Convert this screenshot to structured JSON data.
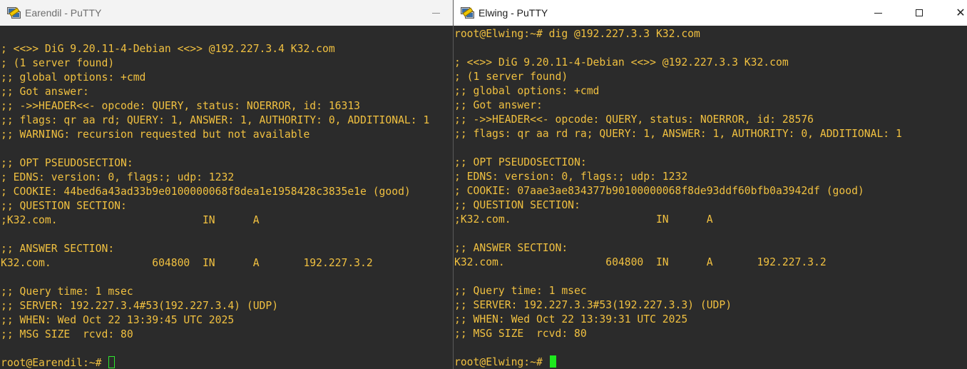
{
  "left_window": {
    "title": "Earendil - PuTTY",
    "icon": "putty-icon",
    "lines": [
      "",
      "; <<>> DiG 9.20.11-4-Debian <<>> @192.227.3.4 K32.com",
      "; (1 server found)",
      ";; global options: +cmd",
      ";; Got answer:",
      ";; ->>HEADER<<- opcode: QUERY, status: NOERROR, id: 16313",
      ";; flags: qr aa rd; QUERY: 1, ANSWER: 1, AUTHORITY: 0, ADDITIONAL: 1",
      ";; WARNING: recursion requested but not available",
      "",
      ";; OPT PSEUDOSECTION:",
      "; EDNS: version: 0, flags:; udp: 1232",
      "; COOKIE: 44bed6a43ad33b9e0100000068f8dea1e1958428c3835e1e (good)",
      ";; QUESTION SECTION:",
      ";K32.com.                       IN      A",
      "",
      ";; ANSWER SECTION:",
      "K32.com.                604800  IN      A       192.227.3.2",
      "",
      ";; Query time: 1 msec",
      ";; SERVER: 192.227.3.4#53(192.227.3.4) (UDP)",
      ";; WHEN: Wed Oct 22 13:39:45 UTC 2025",
      ";; MSG SIZE  rcvd: 80",
      ""
    ],
    "prompt": "root@Earendil:~# "
  },
  "right_window": {
    "title": "Elwing - PuTTY",
    "icon": "putty-icon",
    "lines": [
      "root@Elwing:~# dig @192.227.3.3 K32.com",
      "",
      "; <<>> DiG 9.20.11-4-Debian <<>> @192.227.3.3 K32.com",
      "; (1 server found)",
      ";; global options: +cmd",
      ";; Got answer:",
      ";; ->>HEADER<<- opcode: QUERY, status: NOERROR, id: 28576",
      ";; flags: qr aa rd ra; QUERY: 1, ANSWER: 1, AUTHORITY: 0, ADDITIONAL: 1",
      "",
      ";; OPT PSEUDOSECTION:",
      "; EDNS: version: 0, flags:; udp: 1232",
      "; COOKIE: 07aae3ae834377b90100000068f8de93ddf60bfb0a3942df (good)",
      ";; QUESTION SECTION:",
      ";K32.com.                       IN      A",
      "",
      ";; ANSWER SECTION:",
      "K32.com.                604800  IN      A       192.227.3.2",
      "",
      ";; Query time: 1 msec",
      ";; SERVER: 192.227.3.3#53(192.227.3.3) (UDP)",
      ";; WHEN: Wed Oct 22 13:39:31 UTC 2025",
      ";; MSG SIZE  rcvd: 80",
      ""
    ],
    "prompt": "root@Elwing:~# "
  },
  "colors": {
    "terminal_bg": "#2b2b2b",
    "terminal_text": "#f0c040",
    "cursor": "#1ee81e"
  }
}
